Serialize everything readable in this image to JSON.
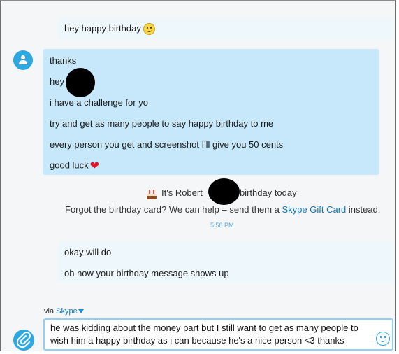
{
  "messages": {
    "sent_1": {
      "text": "hey happy birthday"
    },
    "received": {
      "lines": [
        "thanks",
        "hey",
        "i have a challenge for yo",
        "try and get as many people to say happy birthday to me",
        "every person you get and screenshot I'll give you 50 cents",
        "good luck"
      ]
    },
    "birthday_notice": {
      "line1_prefix": "It's Robert",
      "line1_suffix": "s birthday today",
      "line2_prefix": "Forgot the birthday card? We can help – send them a ",
      "line2_link": "Skype Gift Card",
      "line2_suffix": " instead.",
      "time": "5:58 PM"
    },
    "sent_2": {
      "lines": [
        "okay will do",
        "oh now your birthday message shows up"
      ]
    }
  },
  "compose": {
    "via_label": "via",
    "via_service": "Skype",
    "draft_text": "he was kidding about the money part but I still want to get as many people to wish him a happy birthday as i can because he's a nice person <3 thanks"
  },
  "icons": {
    "avatar": "user-avatar-icon",
    "attach": "paperclip-icon",
    "emoticon": "smiley-icon",
    "cake": "birthday-cake-icon",
    "heart": "heart-icon"
  },
  "colors": {
    "accent": "#2fa8e1",
    "received_bubble": "#c7e8fa",
    "sent_bubble": "#eef7fc",
    "link": "#1577b8"
  }
}
